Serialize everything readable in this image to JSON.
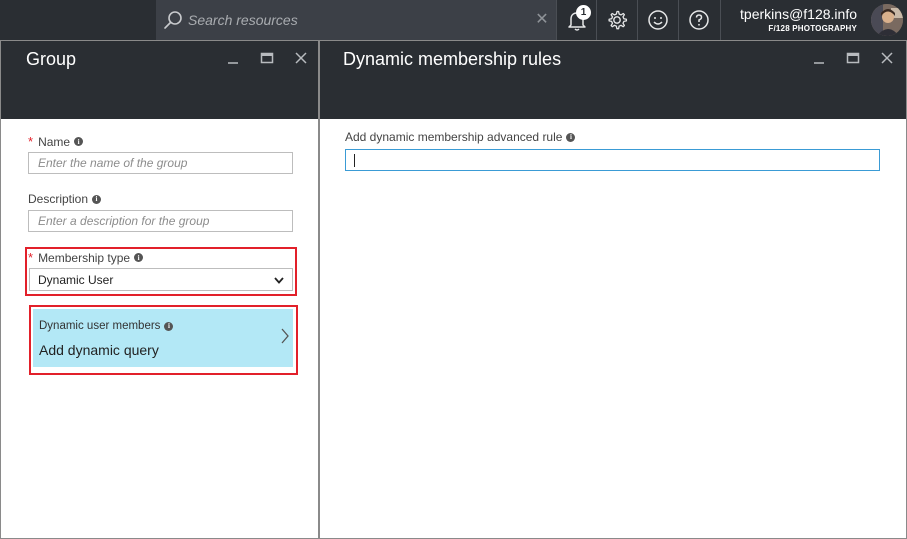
{
  "topbar": {
    "search_placeholder": "Search resources",
    "search_clear": "✕",
    "notifications_count": "1",
    "user_email": "tperkins@f128.info",
    "org_name": "F/128 PHOTOGRAPHY"
  },
  "group_blade": {
    "title": "Group",
    "name_label": "Name",
    "name_placeholder": "Enter the name of the group",
    "description_label": "Description",
    "description_placeholder": "Enter a description for the group",
    "membership_label": "Membership type",
    "membership_value": "Dynamic User",
    "dynamic_label": "Dynamic user members",
    "dynamic_value": "Add dynamic query",
    "required_mark": "*",
    "info_mark": "i"
  },
  "rules_blade": {
    "title": "Dynamic membership rules",
    "rule_label": "Add dynamic membership advanced rule",
    "rule_value": ""
  },
  "colors": {
    "topbar_bg": "#2a2e33",
    "search_bg": "#3c4047",
    "tile_bg": "#b3e8f6",
    "highlight_red": "#e2202a",
    "input_focus_border": "#3a9bd5"
  }
}
